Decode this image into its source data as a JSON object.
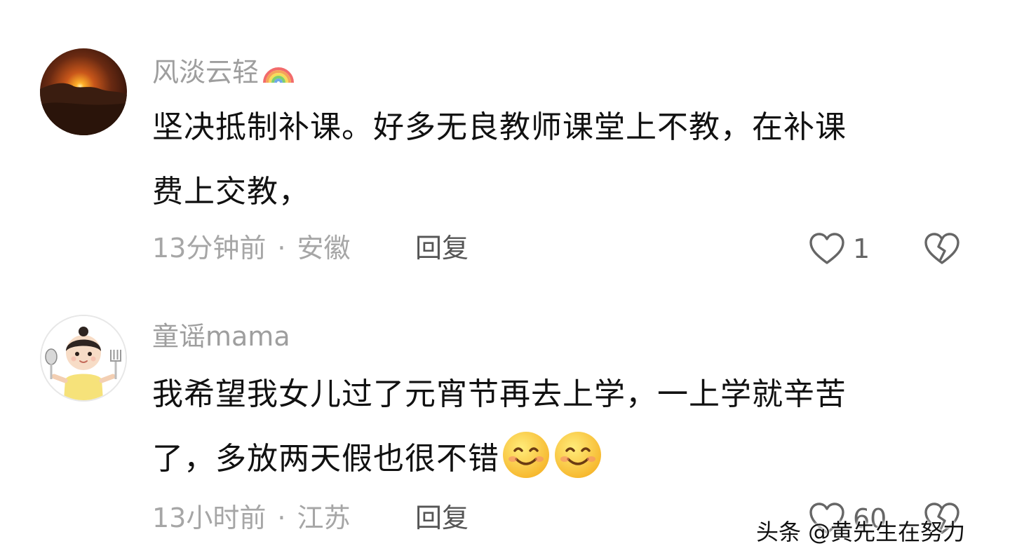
{
  "comments": [
    {
      "username": "风淡云轻",
      "username_badge_icon": "rainbow-icon",
      "text_line_1": "坚决抵制补课。好多无良教师课堂上不教，在补课",
      "text_line_2": "费上交教，",
      "time": "13分钟前",
      "separator": "·",
      "location": "安徽",
      "reply_label": "回复",
      "like_count": "1",
      "avatar": "sunset-avatar"
    },
    {
      "username": "童谣mama",
      "text_line_1": "我希望我女儿过了元宵节再去上学，一上学就辛苦",
      "text_line_2": "了，多放两天假也很不错",
      "trailing_emoji": [
        "smiling-face-emoji",
        "smiling-face-emoji"
      ],
      "time": "13小时前",
      "separator": "·",
      "location": "江苏",
      "reply_label": "回复",
      "like_count": "60",
      "avatar": "cartoon-child-avatar"
    }
  ],
  "watermark": "头条 @黄先生在努力",
  "colors": {
    "username": "#9e9e9e",
    "body_text": "#111111",
    "meta": "#a6a6a6",
    "reply": "#555555",
    "icon_stroke": "#666666"
  }
}
